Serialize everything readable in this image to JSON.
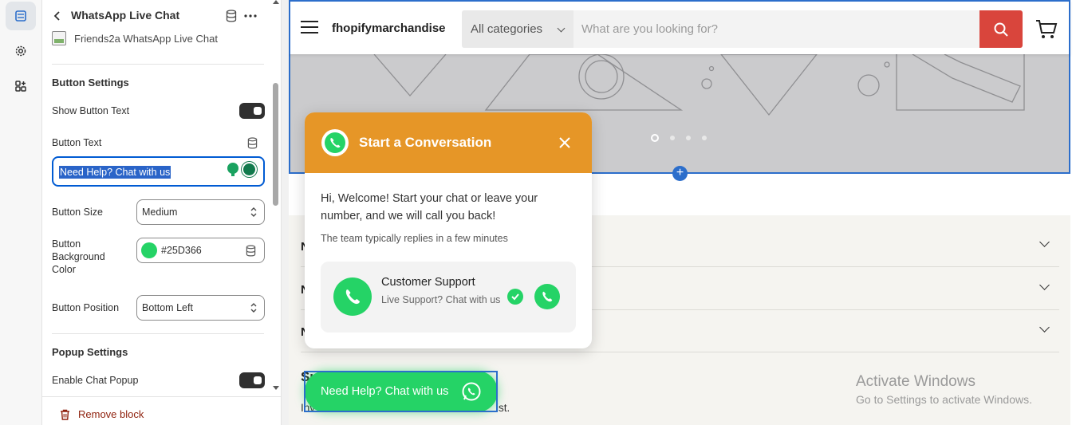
{
  "editor": {
    "panel_title": "WhatsApp Live Chat",
    "app_name": "Friends2a WhatsApp Live Chat",
    "button_settings": {
      "heading": "Button Settings",
      "show_button_text_label": "Show Button Text",
      "button_text_label": "Button Text",
      "button_text_value": "Need Help? Chat with us",
      "button_size_label": "Button Size",
      "button_size_value": "Medium",
      "bg_color_label_1": "Button",
      "bg_color_label_2": "Background",
      "bg_color_label_3": "Color",
      "bg_color_value": "#25D366",
      "position_label": "Button Position",
      "position_value": "Bottom Left"
    },
    "popup_settings": {
      "heading": "Popup Settings",
      "enable_chat_popup_label": "Enable Chat Popup"
    },
    "remove_block_label": "Remove block"
  },
  "store": {
    "name": "fhopifymarchandise",
    "category_value": "All categories",
    "search_placeholder": "What are you looking for?",
    "subscribe_fragment_start": "Su",
    "subscribe_text_start": "Inv",
    "subscribe_text_end": "ist."
  },
  "chat_popup": {
    "title": "Start a Conversation",
    "welcome": "Hi, Welcome! Start your chat or leave your number, and we will call you back!",
    "reply_time": "The team typically replies in a few minutes",
    "agent_name": "Customer Support",
    "agent_desc": "Live Support? Chat with us"
  },
  "floating_button": {
    "label": "Need Help? Chat with us"
  },
  "watermark": {
    "line1": "Activate Windows",
    "line2": "Go to Settings to activate Windows."
  },
  "colors": {
    "whatsapp_green": "#25D366",
    "popup_header": "#E69627",
    "search_button": "#D9453C",
    "selection_blue": "#2C6ECB"
  }
}
